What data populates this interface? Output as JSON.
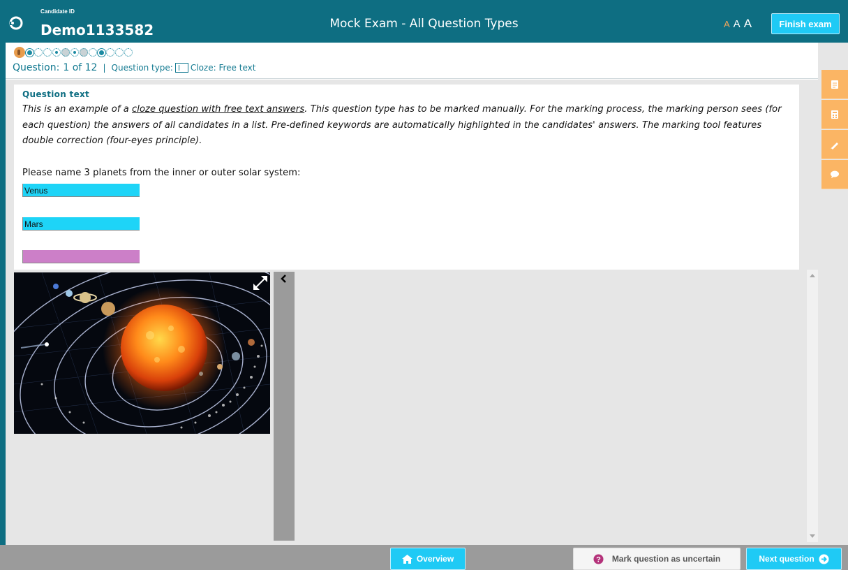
{
  "header": {
    "candidate_label": "Candidate ID",
    "candidate_id": "Demo1133582",
    "exam_title": "Mock Exam - All Question Types",
    "font_sizes": [
      "A",
      "A",
      "A"
    ],
    "finish_label": "Finish exam"
  },
  "navigation": {
    "question_label": "Question:",
    "question_position": "1 of 12",
    "separator": "|",
    "type_label": "Question type:",
    "type_value": "Cloze: Free text",
    "question_dots": [
      {
        "state": "current"
      },
      {
        "state": "answered"
      },
      {
        "state": "open"
      },
      {
        "state": "open"
      },
      {
        "state": "partial"
      },
      {
        "state": "flagged"
      },
      {
        "state": "partial"
      },
      {
        "state": "flagged"
      },
      {
        "state": "open"
      },
      {
        "state": "answered"
      },
      {
        "state": "open"
      },
      {
        "state": "open"
      },
      {
        "state": "open"
      }
    ]
  },
  "question": {
    "heading": "Question text",
    "text_before_link": "This is an example of a ",
    "text_link": "cloze question with free text answers",
    "text_after_link": ". This question type has to be marked manually. For the marking process, the marking person sees (for each question) the answers of all candidates in a list. Pre-defined keywords are automatically highlighted in the candidates' answers. The marking tool features double correction (four-eyes principle).",
    "prompt": "Please name 3 planets from the inner or outer solar system:",
    "answers": [
      "Venus",
      "Mars",
      ""
    ]
  },
  "tools": [
    "notes-icon",
    "calculator-icon",
    "highlighter-icon",
    "comment-icon"
  ],
  "footer": {
    "overview_label": "Overview",
    "uncertain_label": "Mark question as uncertain",
    "next_label": "Next question"
  },
  "colors": {
    "brand_teal": "#0e6e82",
    "accent_cyan": "#1fcaf5",
    "tool_orange": "#fbb564",
    "answer_filled": "#1ed4f7",
    "answer_empty": "#cc7fc8"
  }
}
